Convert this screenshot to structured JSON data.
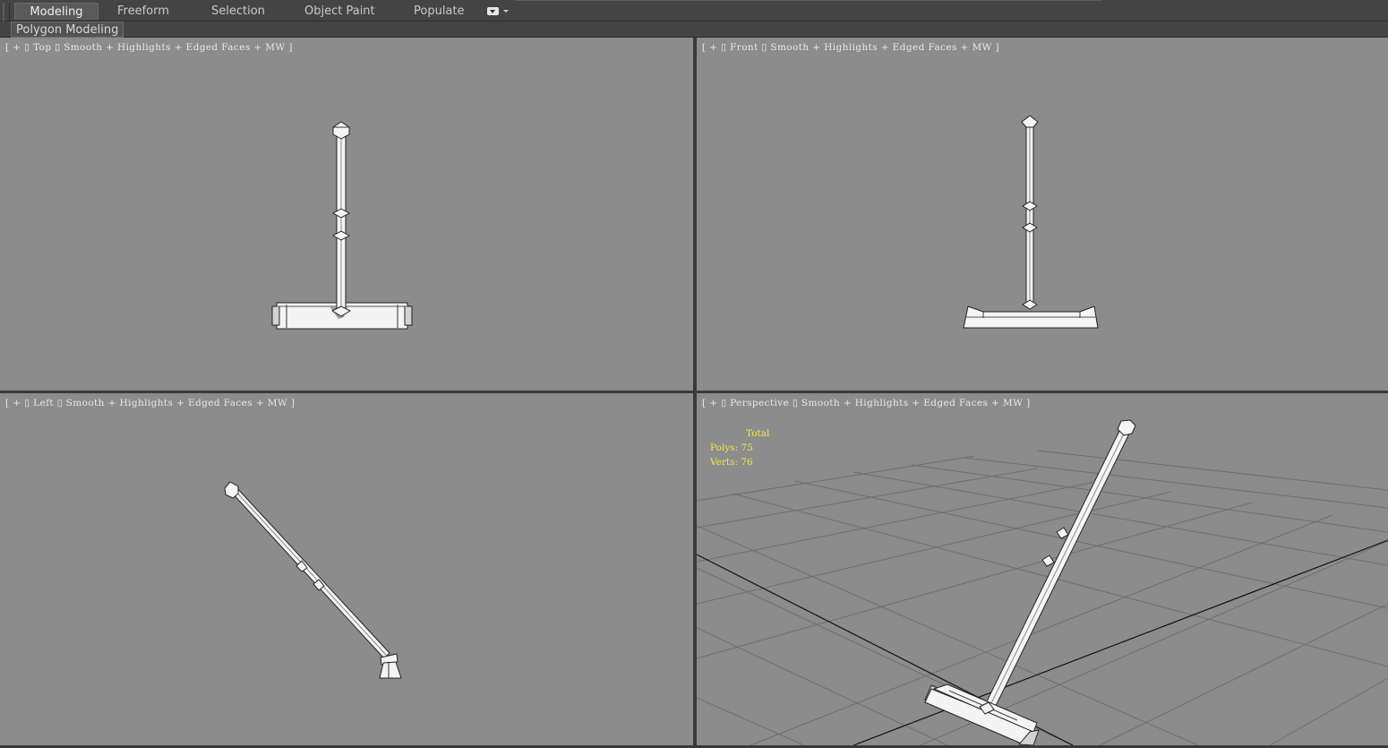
{
  "ribbon": {
    "tabs": [
      {
        "label": "Modeling",
        "active": true
      },
      {
        "label": "Freeform",
        "active": false
      },
      {
        "label": "Selection",
        "active": false
      },
      {
        "label": "Object Paint",
        "active": false
      },
      {
        "label": "Populate",
        "active": false
      }
    ],
    "dropdown_icon": "ribbon-options-icon"
  },
  "subribbon": {
    "panel_label": "Polygon Modeling"
  },
  "viewports": {
    "top": {
      "plus": "+",
      "view": "Top",
      "shading": "Smooth + Highlights + Edged Faces + MW"
    },
    "front": {
      "plus": "+",
      "view": "Front",
      "shading": "Smooth + Highlights + Edged Faces + MW"
    },
    "left": {
      "plus": "+",
      "view": "Left",
      "shading": "Smooth + Highlights + Edged Faces + MW"
    },
    "perspective": {
      "plus": "+",
      "view": "Perspective",
      "shading": "Smooth + Highlights + Edged Faces + MW"
    }
  },
  "stats": {
    "title": "Total",
    "polys_label": "Polys:",
    "polys_value": "75",
    "verts_label": "Verts:",
    "verts_value": "76"
  },
  "colors": {
    "viewport_bg": "#8c8c8c",
    "ui_bg": "#444444",
    "stats_text": "#f2e84a",
    "label_text": "#e8e8e8"
  }
}
